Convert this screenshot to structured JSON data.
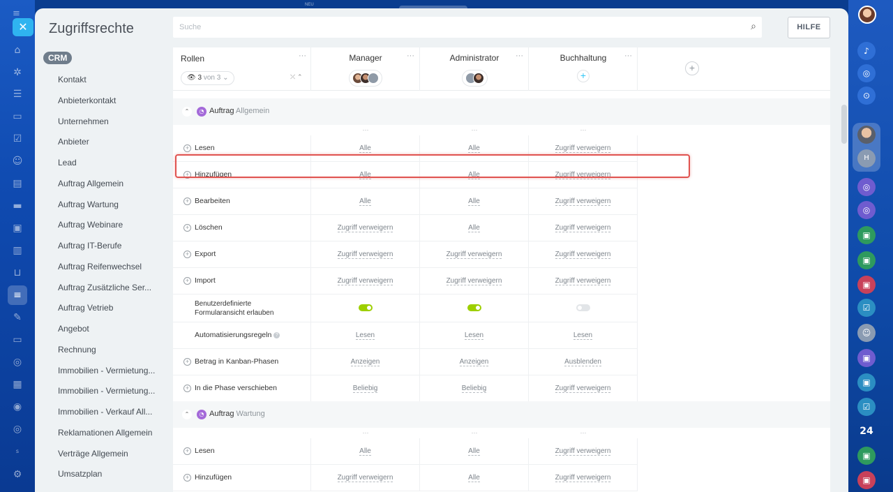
{
  "top_strip": {
    "label": "NEU"
  },
  "panel": {
    "title": "Zugriffsrechte",
    "help_label": "HILFE"
  },
  "search": {
    "placeholder": "Suche"
  },
  "menu": {
    "badge": "CRM",
    "items": [
      "Kontakt",
      "Anbieterkontakt",
      "Unternehmen",
      "Anbieter",
      "Lead",
      "Auftrag Allgemein",
      "Auftrag Wartung",
      "Auftrag Webinare",
      "Auftrag IT-Berufe",
      "Auftrag Reifenwechsel",
      "Auftrag Zusätzliche Ser...",
      "Auftrag Vetrieb",
      "Angebot",
      "Rechnung",
      "Immobilien - Vermietung...",
      "Immobilien - Vermietung...",
      "Immobilien - Verkauf All...",
      "Reklamationen Allgemein",
      "Verträge Allgemein",
      "Umsatzplan"
    ]
  },
  "table": {
    "roles_header": "Rollen",
    "counter": {
      "count": "3",
      "of": "von 3"
    },
    "columns": [
      "Manager",
      "Administrator",
      "Buchhaltung"
    ],
    "sections": [
      {
        "name": "Auftrag",
        "sub": "Allgemein",
        "rows": [
          {
            "label": "Lesen",
            "values": [
              "Alle",
              "Alle",
              "Zugriff verweigern"
            ]
          },
          {
            "label": "Hinzufügen",
            "values": [
              "Alle",
              "Alle",
              "Zugriff verweigern"
            ]
          },
          {
            "label": "Bearbeiten",
            "values": [
              "Alle",
              "Alle",
              "Zugriff verweigern"
            ]
          },
          {
            "label": "Löschen",
            "values": [
              "Zugriff verweigern",
              "Alle",
              "Zugriff verweigern"
            ]
          },
          {
            "label": "Export",
            "values": [
              "Zugriff verweigern",
              "Zugriff verweigern",
              "Zugriff verweigern"
            ]
          },
          {
            "label": "Import",
            "values": [
              "Zugriff verweigern",
              "Zugriff verweigern",
              "Zugriff verweigern"
            ]
          },
          {
            "label": "Benutzerdefinierte Formularansicht erlauben",
            "toggles": [
              true,
              true,
              false
            ]
          },
          {
            "label": "Automatisierungsregeln",
            "values": [
              "Lesen",
              "Lesen",
              "Lesen"
            ]
          },
          {
            "label": "Betrag in Kanban-Phasen",
            "values": [
              "Anzeigen",
              "Anzeigen",
              "Ausblenden"
            ]
          },
          {
            "label": "In die Phase verschieben",
            "values": [
              "Beliebig",
              "Beliebig",
              "Zugriff verweigern"
            ]
          }
        ]
      },
      {
        "name": "Auftrag",
        "sub": "Wartung",
        "rows": [
          {
            "label": "Lesen",
            "values": [
              "Alle",
              "Alle",
              "Zugriff verweigern"
            ]
          },
          {
            "label": "Hinzufügen",
            "values": [
              "Zugriff verweigern",
              "Alle",
              "Zugriff verweigern"
            ]
          }
        ]
      }
    ]
  },
  "right_rail": {
    "counter_badge": "24"
  },
  "colors": {
    "accent": "#2fc6f6",
    "toggle_on": "#9dcf00",
    "highlight": "#e0524f",
    "rail": "#0f4ab0"
  }
}
